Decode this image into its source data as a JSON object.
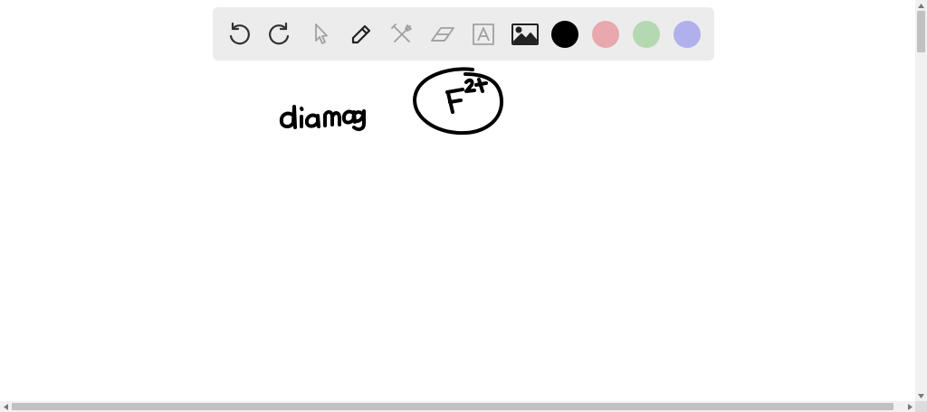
{
  "toolbar": {
    "tools": [
      {
        "name": "undo-button",
        "icon": "undo-icon"
      },
      {
        "name": "redo-button",
        "icon": "redo-icon"
      },
      {
        "name": "select-button",
        "icon": "cursor-icon"
      },
      {
        "name": "pen-button",
        "icon": "pen-icon"
      },
      {
        "name": "tools-button",
        "icon": "tools-icon"
      },
      {
        "name": "eraser-button",
        "icon": "eraser-icon"
      },
      {
        "name": "text-button",
        "icon": "text-box-icon"
      },
      {
        "name": "image-button",
        "icon": "image-icon"
      }
    ],
    "colors": [
      {
        "name": "color-black",
        "hex": "#000000"
      },
      {
        "name": "color-pink",
        "hex": "#e8a8ae"
      },
      {
        "name": "color-green",
        "hex": "#b4d8b0"
      },
      {
        "name": "color-lavender",
        "hex": "#b0b0ec"
      }
    ],
    "background": "#ececec"
  },
  "canvas": {
    "background": "#ffffff",
    "ink_color": "#000000",
    "handwriting": "diamag  F2+"
  }
}
